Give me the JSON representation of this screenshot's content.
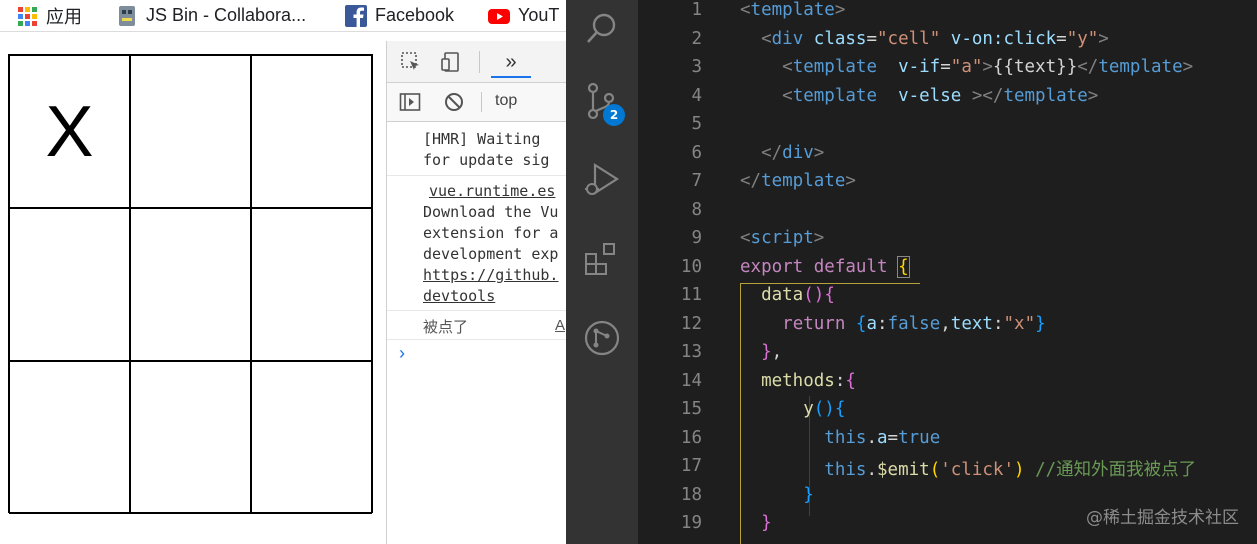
{
  "bookmarks": [
    {
      "label": "应用",
      "icon": "apps-grid-icon"
    },
    {
      "label": "JS Bin - Collabora...",
      "icon": "jsbin-icon"
    },
    {
      "label": "Facebook",
      "icon": "facebook-icon"
    },
    {
      "label": "YouT",
      "icon": "youtube-icon"
    }
  ],
  "board": {
    "cells": [
      "X",
      "",
      "",
      "",
      "",
      "",
      "",
      "",
      ""
    ]
  },
  "devtools": {
    "context": "top",
    "console": {
      "hmr_line1": "[HMR] Waiting ",
      "hmr_line2": "for update sig",
      "source_link": "vue.runtime.es",
      "vue_line1": "Download the Vu",
      "vue_line2": "extension for a",
      "vue_line3": "development exp",
      "vue_link1": "https://github.",
      "vue_link2": "devtools",
      "clicked_msg": "被点了",
      "clicked_src": "A"
    }
  },
  "vscode": {
    "scm_badge": "2",
    "line_numbers": [
      "1",
      "2",
      "3",
      "4",
      "5",
      "6",
      "7",
      "8",
      "9",
      "10",
      "11",
      "12",
      "13",
      "14",
      "15",
      "16",
      "17",
      "18",
      "19"
    ],
    "watermark": "@稀土掘金技术社区"
  },
  "colors": {
    "editor_bg": "#1e1e1e",
    "activity_bg": "#333333",
    "badge": "#0078d4"
  }
}
